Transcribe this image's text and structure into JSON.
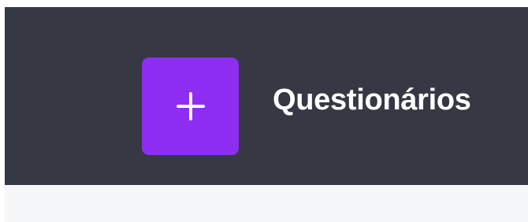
{
  "header": {
    "add_button": {
      "icon": "plus-icon"
    },
    "title": "Questionários"
  },
  "colors": {
    "header_background": "#363844",
    "accent": "#8e2ef2",
    "content_background": "#f6f7f9",
    "title_text": "#ffffff"
  }
}
